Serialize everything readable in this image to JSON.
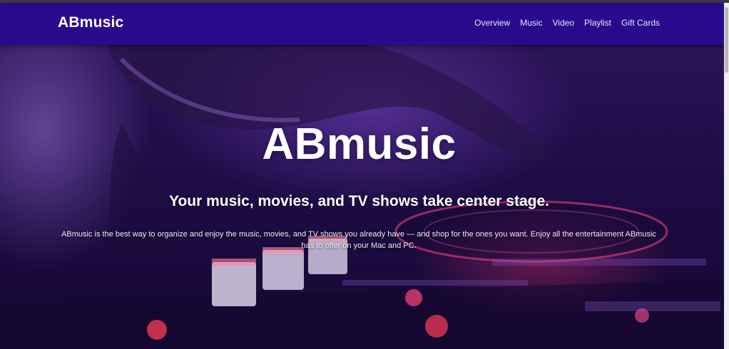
{
  "nav": {
    "brand": "ABmusic",
    "links": [
      "Overview",
      "Music",
      "Video",
      "Playlist",
      "Gift Cards"
    ]
  },
  "hero": {
    "title": "ABmusic",
    "subtitle": "Your music, movies, and TV shows take center stage.",
    "description": "ABmusic is the best way to organize and enjoy the music, movies, and TV shows you already have — and shop for the ones you want. Enjoy all the entertainment ABmusic has to offer on your Mac and PC."
  },
  "colors": {
    "navbar": "#2a0a8c",
    "hero_overlay": "#1e0c46",
    "accent_glow": "#ff3c78",
    "text": "#ffffff"
  }
}
